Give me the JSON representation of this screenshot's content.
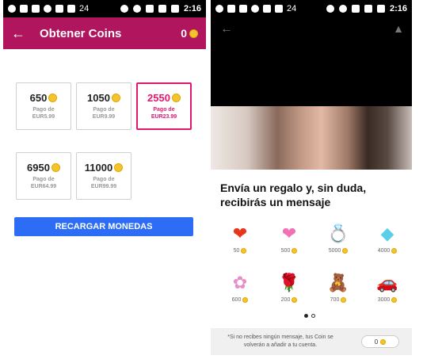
{
  "left": {
    "status": {
      "time": "2:16",
      "signal_label": "24"
    },
    "appbar": {
      "title": "Obtener Coins",
      "balance": "0"
    },
    "packages": [
      {
        "amount": "650",
        "pay_label": "Pago de",
        "price": "EUR5.99",
        "selected": false
      },
      {
        "amount": "1050",
        "pay_label": "Pago de",
        "price": "EUR9.99",
        "selected": false
      },
      {
        "amount": "2550",
        "pay_label": "Pago de",
        "price": "EUR23.99",
        "selected": true
      },
      {
        "amount": "6950",
        "pay_label": "Pago de",
        "price": "EUR64.99",
        "selected": false
      },
      {
        "amount": "11000",
        "pay_label": "Pago de",
        "price": "EUR99.99",
        "selected": false
      }
    ],
    "recharge_label": "RECARGAR MONEDAS"
  },
  "right": {
    "status": {
      "time": "2:16",
      "signal_label": "24"
    },
    "gift_title": "Envía un regalo y, sin duda, recibirás un mensaje",
    "gifts": [
      {
        "icon": "flame-heart-icon",
        "glyph": "❤",
        "color": "#e8361c",
        "price": "50"
      },
      {
        "icon": "cherry-heart-icon",
        "glyph": "❤",
        "color": "#f071b4",
        "price": "500"
      },
      {
        "icon": "ring-icon",
        "glyph": "💍",
        "color": "#d8a42a",
        "price": "5000"
      },
      {
        "icon": "diamond-icon",
        "glyph": "◆",
        "color": "#5ccfe8",
        "price": "4000"
      },
      {
        "icon": "flower-basket-icon",
        "glyph": "✿",
        "color": "#e78dc9",
        "price": "600"
      },
      {
        "icon": "rose-icon",
        "glyph": "🌹",
        "color": "#c4102a",
        "price": "200"
      },
      {
        "icon": "teddy-bear-icon",
        "glyph": "🧸",
        "color": "#b5784a",
        "price": "700"
      },
      {
        "icon": "sports-car-icon",
        "glyph": "🚗",
        "color": "#b81620",
        "price": "3000"
      }
    ],
    "footer_note": "*Si no recibes ningún mensaje, tus Coin se volverán a añadir a tu cuenta.",
    "footer_balance": "0"
  }
}
